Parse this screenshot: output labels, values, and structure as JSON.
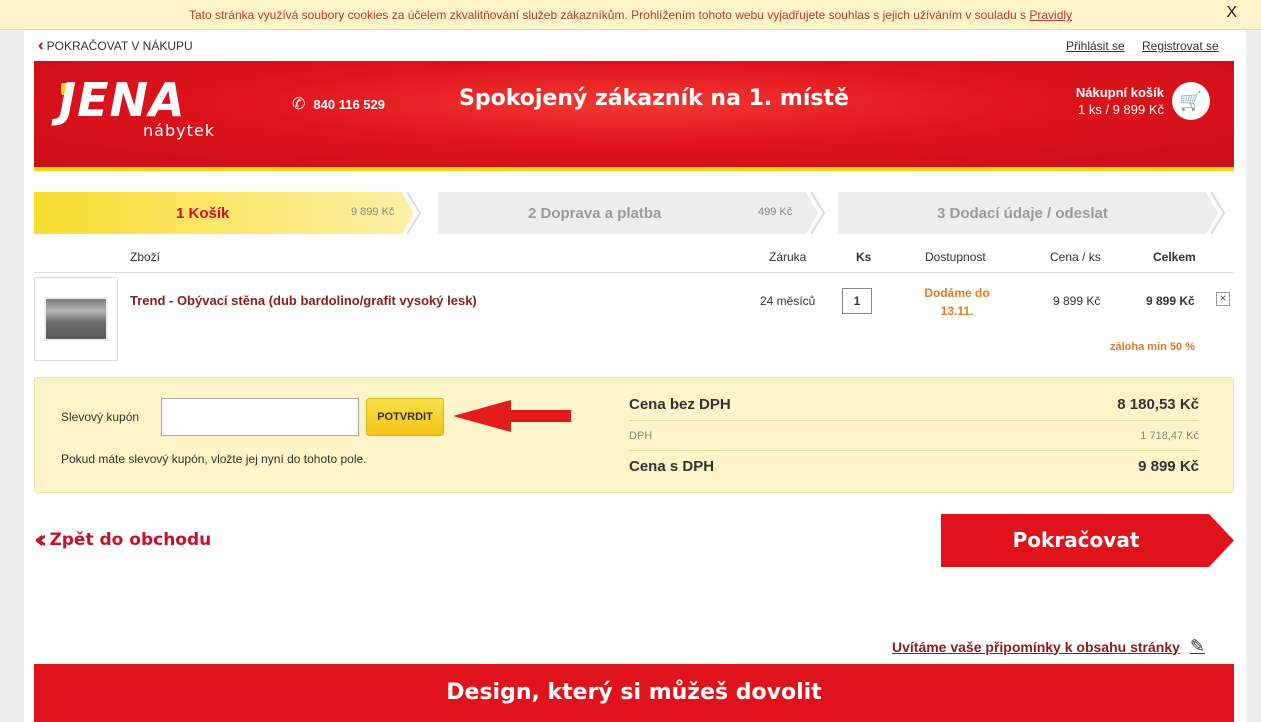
{
  "cookie": {
    "text": "Tato stránka využívá soubory cookies za účelem zkvalitňování služeb zákazníkům. Prohlížením tohoto webu vyjadřujete souhlas s jejich užíváním v souladu s",
    "link": "Pravidly",
    "close": "X"
  },
  "toplinks": {
    "continue": "POKRAČOVAT V NÁKUPU",
    "login": "Přihlásit se",
    "register": "Registrovat se"
  },
  "header": {
    "logo": "JENA",
    "logo_sub": "nábytek",
    "phone": "840 116 529",
    "slogan": "Spokojený zákazník na 1. místě",
    "cart_title": "Nákupní košík",
    "cart_summary": "1 ks / 9 899 Kč",
    "brand_red": "#e0131c",
    "brand_yellow": "#f7d414"
  },
  "steps": [
    {
      "label": "1 Košík",
      "price": "9 899 Kč",
      "active": true
    },
    {
      "label": "2 Doprava a platba",
      "price": "499  Kč",
      "active": false
    },
    {
      "label": "3 Dodací údaje / odeslat",
      "price": "",
      "active": false
    }
  ],
  "table": {
    "headers": {
      "item": "Zboží",
      "warranty": "Záruka",
      "qty": "Ks",
      "availability": "Dostupnost",
      "unit_price": "Cena / ks",
      "total": "Celkem"
    },
    "row": {
      "name": "Trend - Obývací stěna (dub bardolino/grafit vysoký lesk)",
      "warranty": "24 měsíců",
      "qty": "1",
      "availability": "Dodáme do 13.11.",
      "unit_price": "9 899 Kč",
      "total": "9 899 Kč",
      "deposit": "záloha min 50 %"
    }
  },
  "coupon": {
    "label": "Slevový kupón",
    "value": "",
    "button": "POTVRDIT",
    "hint": "Pokud máte slevový kupón, vložte jej nyní do tohoto pole."
  },
  "summary": {
    "bez_label": "Cena bez DPH",
    "bez_value": "8 180,53 Kč",
    "dph_label": "DPH",
    "dph_value": "1 718,47 Kč",
    "s_label": "Cena s DPH",
    "s_value": "9 899 Kč"
  },
  "actions": {
    "back": "Zpět do obchodu",
    "continue": "Pokračovat",
    "feedback": "Uvítáme vaše připomínky k obsahu stránky"
  },
  "footer": {
    "banner": "Design, který si můžeš dovolit"
  }
}
